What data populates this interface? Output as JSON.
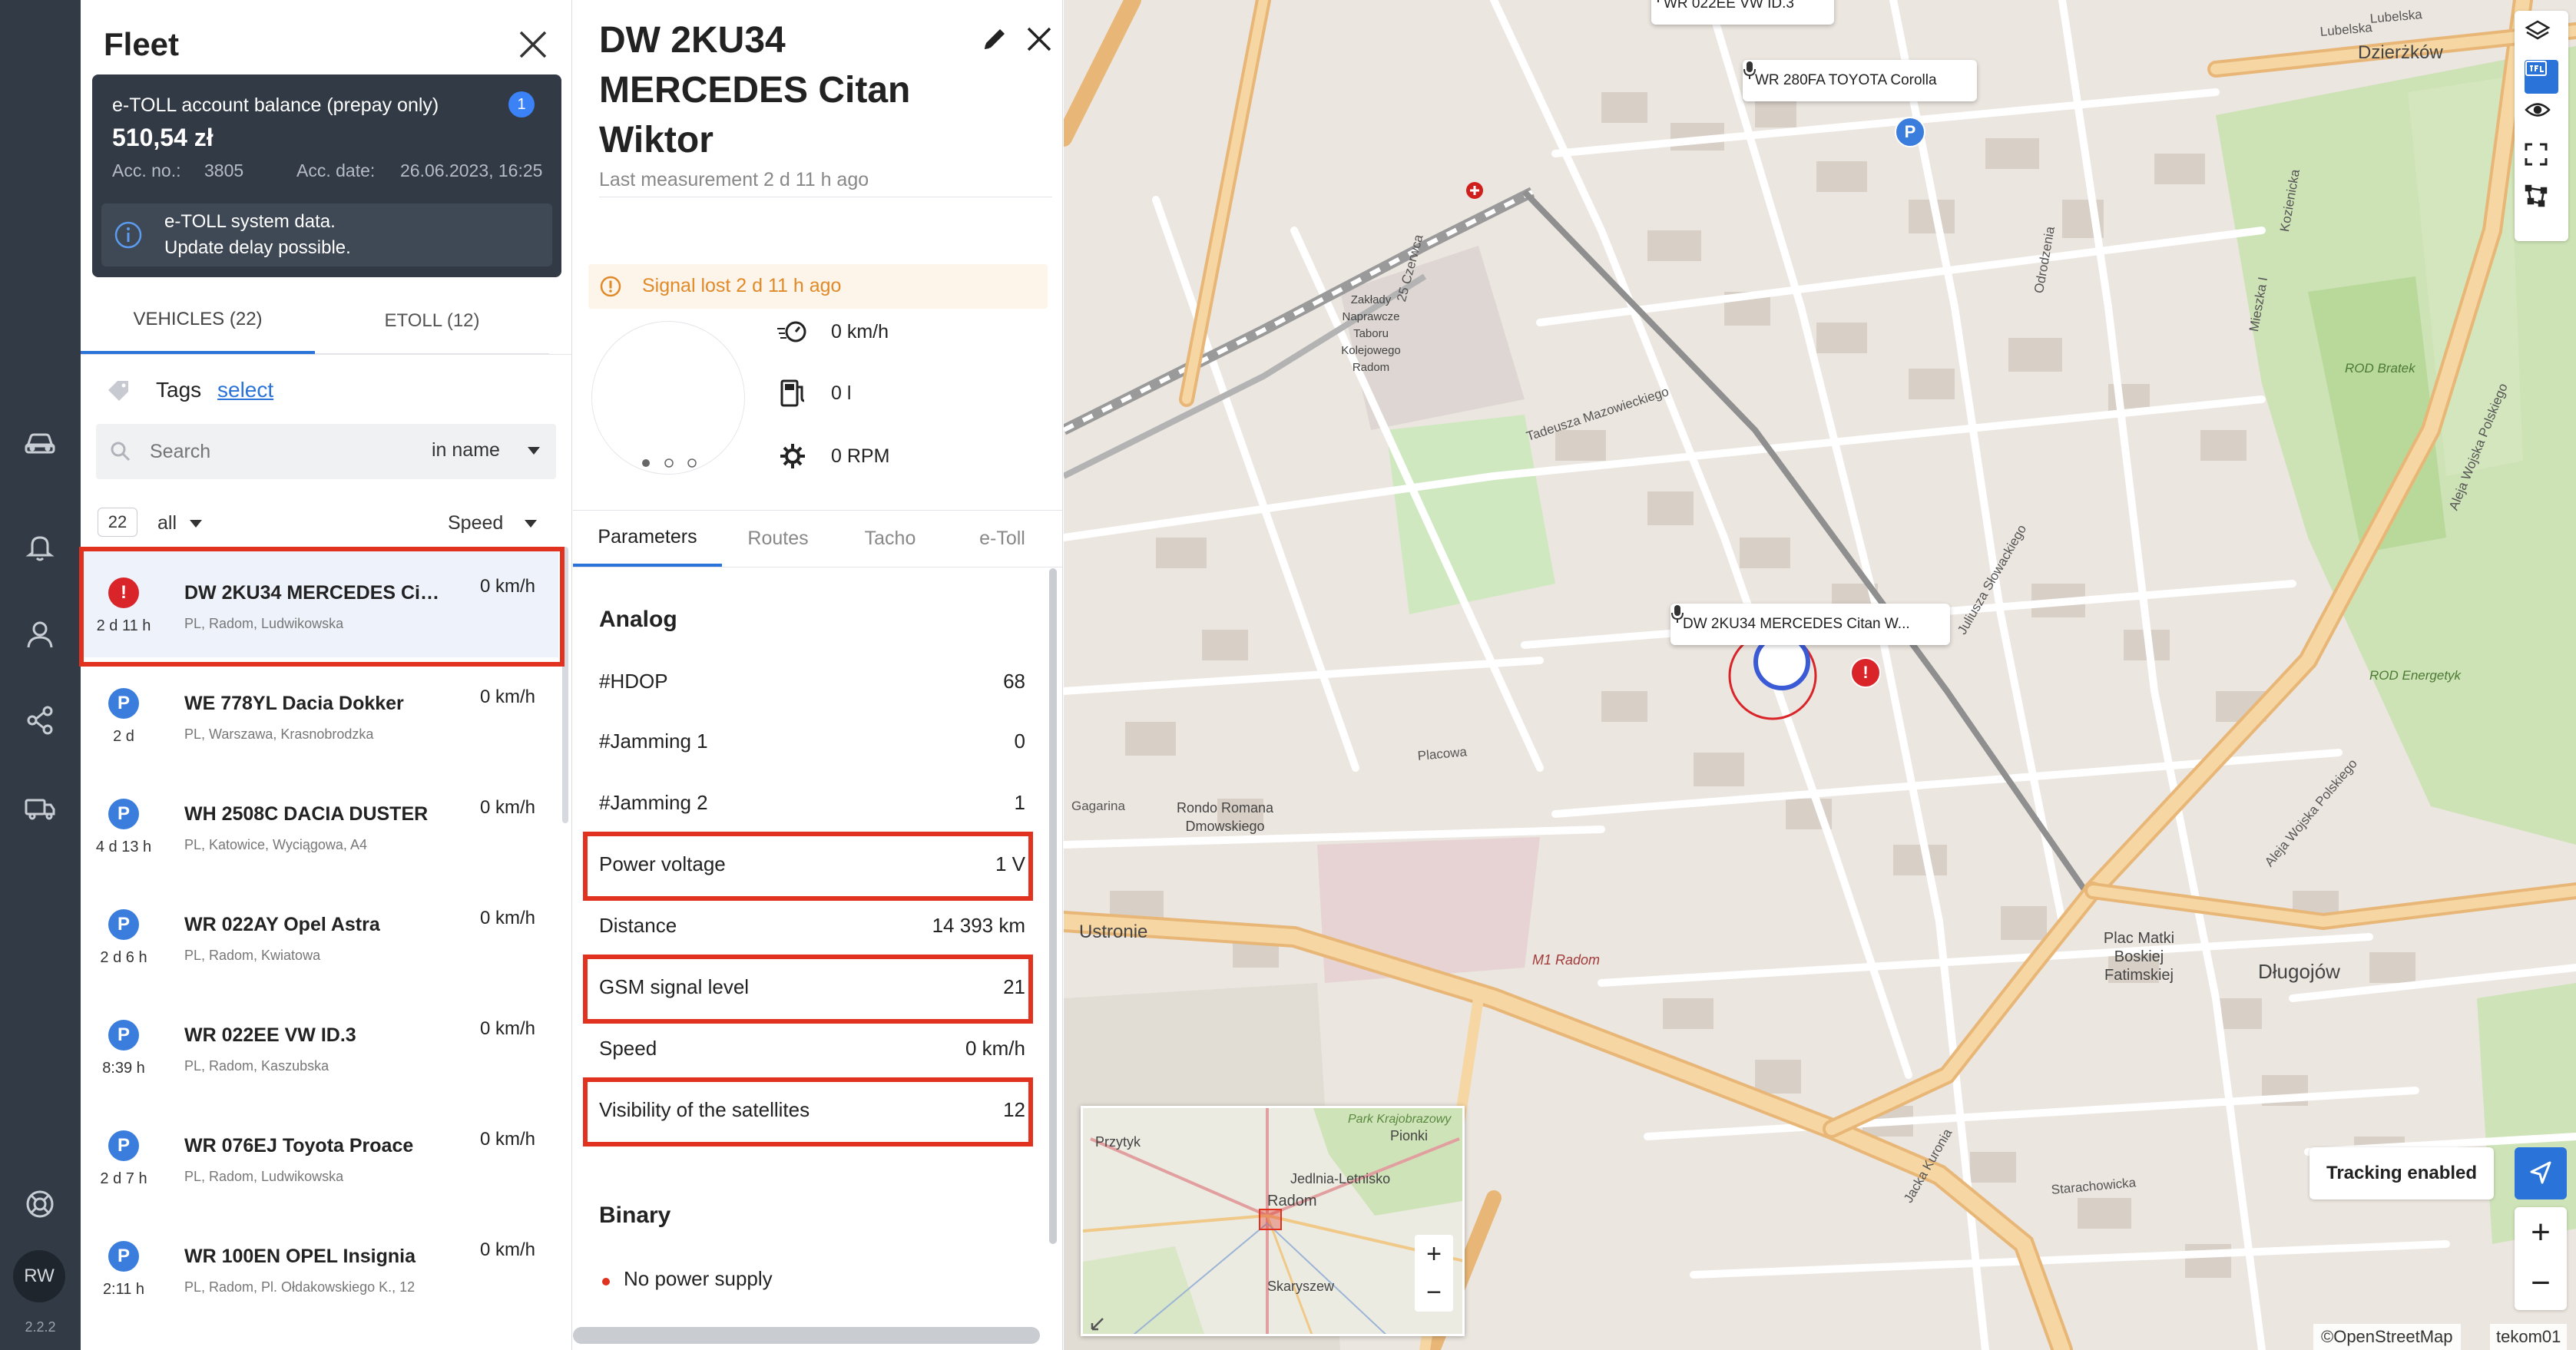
{
  "fleet": {
    "title": "Fleet",
    "etoll_card": {
      "label": "e-TOLL account balance (prepay only)",
      "badge": "1",
      "balance": "510,54 zł",
      "acc_no_label": "Acc. no.:",
      "acc_no": "3805",
      "acc_date_label": "Acc. date:",
      "acc_date": "26.06.2023, 16:25",
      "info_line1": "e-TOLL system data.",
      "info_line2": "Update delay possible."
    },
    "tabs": [
      {
        "label": "VEHICLES (22)",
        "active": true
      },
      {
        "label": "ETOLL (12)",
        "active": false
      }
    ],
    "tags_label": "Tags",
    "tags_select": "select",
    "search": {
      "placeholder": "Search",
      "mode": "in name"
    },
    "count": "22",
    "filter": "all",
    "sort": "Speed",
    "vehicles": [
      {
        "name": "DW 2KU34 MERCEDES Citan Wiktor",
        "location": "PL, Radom, Ludwikowska",
        "time": "2 d 11 h",
        "speed": "0 km/h",
        "status": "alert",
        "icon": "!",
        "selected": true
      },
      {
        "name": "WE 778YL Dacia Dokker",
        "location": "PL, Warszawa, Krasnobrodzka",
        "time": "2 d",
        "speed": "0 km/h",
        "status": "parked",
        "icon": "P",
        "selected": false
      },
      {
        "name": "WH 2508C DACIA DUSTER",
        "location": "PL, Katowice, Wyciągowa, A4",
        "time": "4 d 13 h",
        "speed": "0 km/h",
        "status": "parked",
        "icon": "P",
        "selected": false
      },
      {
        "name": "WR 022AY Opel Astra",
        "location": "PL, Radom, Kwiatowa",
        "time": "2 d 6 h",
        "speed": "0 km/h",
        "status": "parked",
        "icon": "P",
        "selected": false
      },
      {
        "name": "WR 022EE VW ID.3",
        "location": "PL, Radom, Kaszubska",
        "time": "8:39 h",
        "speed": "0 km/h",
        "status": "parked",
        "icon": "P",
        "selected": false
      },
      {
        "name": "WR 076EJ Toyota Proace",
        "location": "PL, Radom, Ludwikowska",
        "time": "2 d 7 h",
        "speed": "0 km/h",
        "status": "parked",
        "icon": "P",
        "selected": false
      },
      {
        "name": "WR 100EN OPEL Insignia",
        "location": "PL, Radom, Pl. Ołdakowskiego K., 12",
        "time": "2:11 h",
        "speed": "0 km/h",
        "status": "parked",
        "icon": "P",
        "selected": false
      }
    ]
  },
  "rail": {
    "avatar": "RW",
    "version": "2.2.2"
  },
  "detail": {
    "title": "DW 2KU34 MERCEDES Citan Wiktor",
    "last_measurement": "Last measurement 2 d 11 h ago",
    "signal_lost": "Signal lost 2 d 11 h ago",
    "speed": "0 km/h",
    "fuel": "0 l",
    "rpm": "0 RPM",
    "tabs": [
      "Parameters",
      "Routes",
      "Tacho",
      "e-Toll"
    ],
    "analog_title": "Analog",
    "params": [
      {
        "label": "#HDOP",
        "value": "68",
        "highlight": false
      },
      {
        "label": "#Jamming 1",
        "value": "0",
        "highlight": false
      },
      {
        "label": "#Jamming 2",
        "value": "1",
        "highlight": false
      },
      {
        "label": "Power voltage",
        "value": "1 V",
        "highlight": true
      },
      {
        "label": "Distance",
        "value": "14 393 km",
        "highlight": false
      },
      {
        "label": "GSM signal level",
        "value": "21",
        "highlight": true
      },
      {
        "label": "Speed",
        "value": "0 km/h",
        "highlight": false
      },
      {
        "label": "Visibility of the satellites",
        "value": "12",
        "highlight": true
      }
    ],
    "binary_title": "Binary",
    "binary_items": [
      "No power supply"
    ]
  },
  "map": {
    "labels": [
      {
        "text": "WR 022EE VW ID.3"
      },
      {
        "text": "WR 280FA TOYOTA Corolla"
      },
      {
        "text": "DW 2KU34 MERCEDES Citan W..."
      }
    ],
    "places": [
      "Dzierżków",
      "Długojów",
      "Plac Matki Boskiej Fatimskiej",
      "Rondo Romana Dmowskiego",
      "Ustronie",
      "M1 Radom",
      "Zakłady Naprawcze Taboru Kolejowego Radom",
      "ROD Bratek",
      "ROD Energetyk",
      "Przytyk",
      "Pionki",
      "Jedlnia-Letnisko",
      "Radom",
      "Skaryszew",
      "Park Krajobrazowy"
    ],
    "streets": [
      "Lubelska",
      "Aleja Wojska Polskiego",
      "Aleja Wojska Polskiego",
      "Jacka Kuronia",
      "25 Czerwca",
      "Tadeusza Mazowieckiego",
      "Juliusza Słowackiego",
      "Mieszka I",
      "Gagarina",
      "Placowa",
      "Kozienicka",
      "Starachowicka",
      "Odrodzenia",
      "Lubelska"
    ],
    "tracking": "Tracking enabled",
    "attribution": "©OpenStreetMap",
    "user": "tekom01",
    "colors": {
      "accent": "#2a73d9",
      "highlight": "#e0321f",
      "alert": "#d9252a",
      "parked": "#3b7ddd"
    }
  }
}
